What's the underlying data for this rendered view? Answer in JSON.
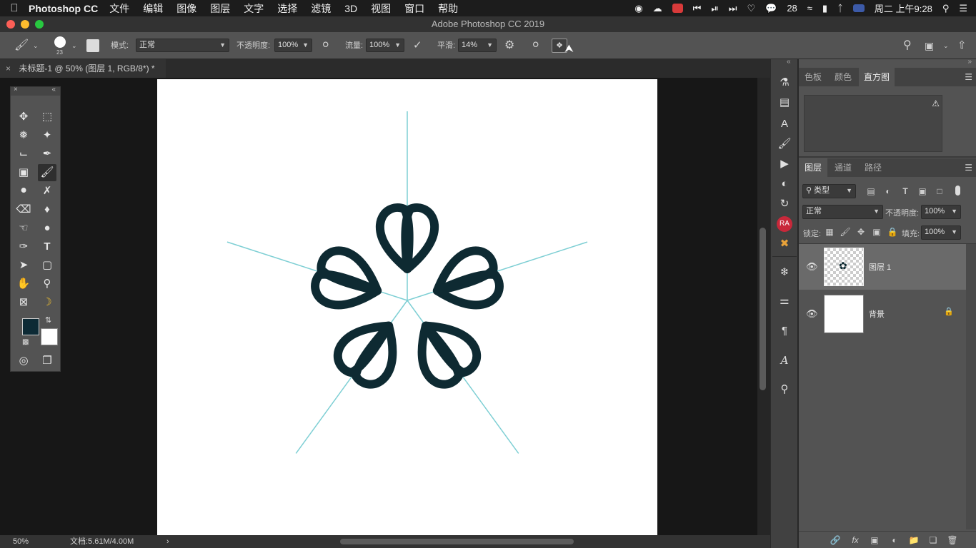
{
  "menubar": {
    "app_name": "Photoshop CC",
    "items": [
      "文件",
      "编辑",
      "图像",
      "图层",
      "文字",
      "选择",
      "滤镜",
      "3D",
      "视图",
      "窗口",
      "帮助"
    ],
    "wechat_count": "28",
    "clock": "周二 上午9:28"
  },
  "window": {
    "title": "Adobe Photoshop CC 2019"
  },
  "options": {
    "brush_size": "23",
    "mode_label": "模式:",
    "mode_value": "正常",
    "opacity_label": "不透明度:",
    "opacity_value": "100%",
    "flow_label": "流量:",
    "flow_value": "100%",
    "smooth_label": "平滑:",
    "smooth_value": "14%"
  },
  "document": {
    "tab_title": "未标题-1 @ 50% (图层 1, RGB/8*) *",
    "zoom": "50%",
    "doc_info": "文档:5.61M/4.00M"
  },
  "colors": {
    "foreground": "#0d2a35",
    "background": "#ffffff",
    "symmetry_lines": "#7ecfd4",
    "petal": "#0e2a32"
  },
  "tools": [
    "move-tool",
    "marquee-tool",
    "lasso-tool",
    "magic-wand-tool",
    "crop-tool",
    "eyedropper-tool",
    "frame-tool",
    "brush-tool",
    "stamp-tool",
    "history-brush-tool",
    "eraser-tool",
    "paint-bucket-tool",
    "smudge-tool",
    "dodge-tool",
    "pen-tool",
    "type-tool",
    "path-select-tool",
    "rectangle-tool",
    "hand-tool",
    "zoom-tool",
    "frame-x-tool",
    "banana-tool"
  ],
  "panels": {
    "top_tabs": [
      "色板",
      "颜色",
      "直方图"
    ],
    "top_active": "直方图",
    "layer_tabs": [
      "图层",
      "通道",
      "路径"
    ],
    "layer_active": "图层",
    "filter_kind": "类型",
    "blend_mode": "正常",
    "opacity_label": "不透明度:",
    "opacity_value": "100%",
    "lock_label": "锁定:",
    "fill_label": "填充:",
    "fill_value": "100%",
    "layers": [
      {
        "name": "图层 1",
        "selected": true
      },
      {
        "name": "背景",
        "selected": false
      }
    ]
  },
  "icon_strip": {
    "badge": "RA"
  }
}
